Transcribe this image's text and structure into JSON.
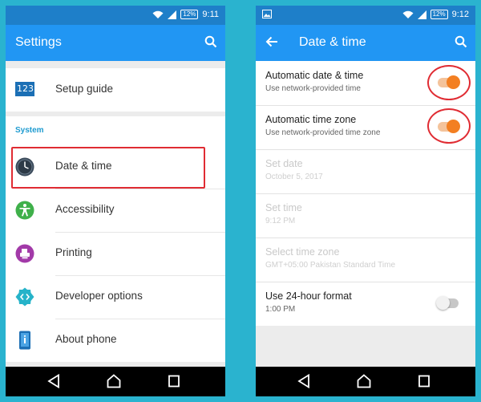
{
  "colors": {
    "background": "#2ab3cf",
    "status_bar": "#1e7fc9",
    "app_bar": "#2196f3",
    "accent_section": "#1e9bd0",
    "highlight": "#e02c33",
    "toggle_on": "#f37f22"
  },
  "left_screen": {
    "status": {
      "battery": "12%",
      "time": "9:11"
    },
    "app_bar": {
      "title": "Settings",
      "search_icon": "search-icon"
    },
    "items_top": [
      {
        "label": "Setup guide",
        "icon": "setup-guide-icon",
        "icon_text": "123"
      }
    ],
    "section_title": "System",
    "items": [
      {
        "label": "Date & time",
        "icon": "clock-icon"
      },
      {
        "label": "Accessibility",
        "icon": "accessibility-icon"
      },
      {
        "label": "Printing",
        "icon": "printer-icon"
      },
      {
        "label": "Developer options",
        "icon": "developer-options-icon"
      },
      {
        "label": "About phone",
        "icon": "phone-info-icon"
      }
    ],
    "nav": [
      "back-icon",
      "home-icon",
      "recents-icon"
    ]
  },
  "right_screen": {
    "status": {
      "battery": "12%",
      "time": "9:12"
    },
    "app_bar": {
      "title": "Date & time",
      "back_icon": "arrow-back-icon",
      "search_icon": "search-icon"
    },
    "settings": [
      {
        "title": "Automatic date & time",
        "summary": "Use network-provided time",
        "toggle": true,
        "enabled": true
      },
      {
        "title": "Automatic time zone",
        "summary": "Use network-provided time zone",
        "toggle": true,
        "enabled": true
      },
      {
        "title": "Set date",
        "summary": "October 5, 2017",
        "enabled": false
      },
      {
        "title": "Set time",
        "summary": "9:12 PM",
        "enabled": false
      },
      {
        "title": "Select time zone",
        "summary": "GMT+05:00 Pakistan Standard Time",
        "enabled": false
      },
      {
        "title": "Use 24-hour format",
        "summary": "1:00 PM",
        "toggle": false,
        "enabled": true
      }
    ],
    "nav": [
      "back-icon",
      "home-icon",
      "recents-icon"
    ]
  }
}
